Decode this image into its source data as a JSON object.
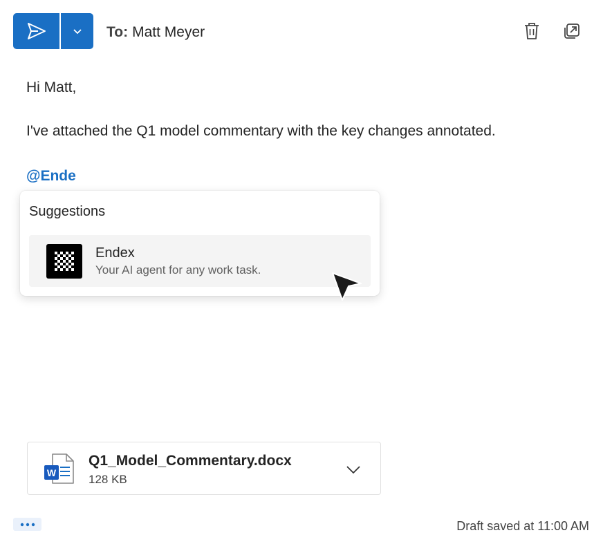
{
  "compose": {
    "to_label": "To:",
    "to_value": "Matt Meyer",
    "icons": {
      "send": "send-icon",
      "send_options": "chevron-down-icon",
      "delete": "trash-icon",
      "popout": "popout-icon"
    }
  },
  "body": {
    "greeting": "Hi Matt,",
    "paragraph": "I've attached the Q1 model commentary with the key changes annotated.",
    "mention": "@Ende"
  },
  "suggestions": {
    "title": "Suggestions",
    "items": [
      {
        "name": "Endex",
        "description": "Your AI agent for any work task.",
        "icon": "endex-logo-icon"
      }
    ]
  },
  "attachment": {
    "file_name": "Q1_Model_Commentary.docx",
    "file_size": "128 KB",
    "icon": "word-document-icon"
  },
  "footer": {
    "more": "more-options-icon",
    "status": "Draft saved at 11:00 AM"
  },
  "colors": {
    "accent": "#1a6fc4",
    "text": "#242424",
    "muted": "#616161"
  }
}
